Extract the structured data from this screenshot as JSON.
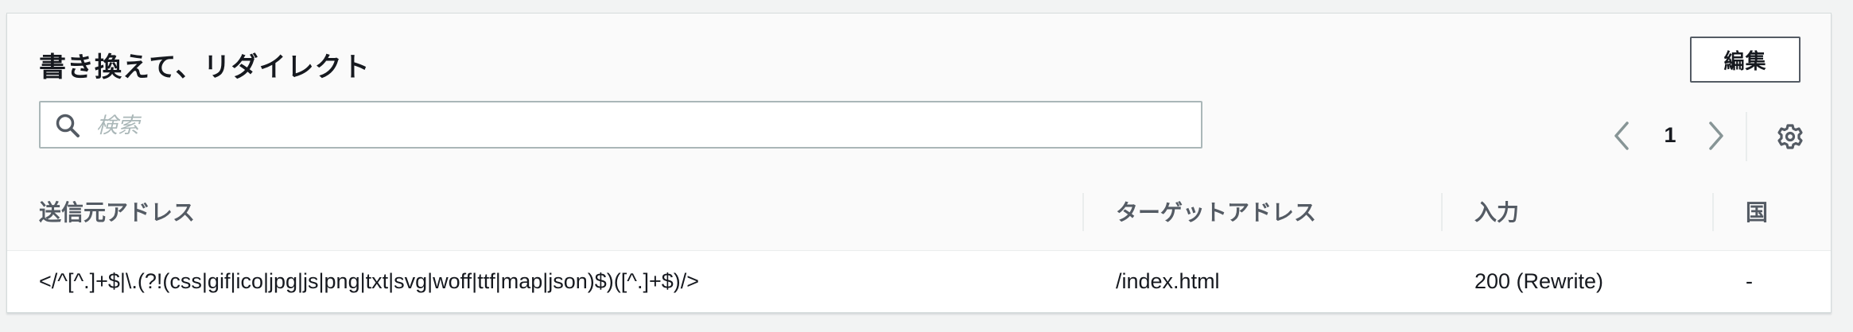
{
  "header": {
    "title": "書き換えて、リダイレクト",
    "edit_label": "編集"
  },
  "search": {
    "placeholder": "検索",
    "value": ""
  },
  "pagination": {
    "current_page": "1"
  },
  "table": {
    "columns": [
      "送信元アドレス",
      "ターゲットアドレス",
      "入力",
      "国"
    ],
    "rows": [
      [
        "</^[^.]+$|\\.(?!(css|gif|ico|jpg|js|png|txt|svg|woff|ttf|map|json)$)([^.]+$)/>",
        "/index.html",
        "200 (Rewrite)",
        "-"
      ]
    ]
  },
  "icons": {
    "search": "search-icon",
    "prev": "chevron-left-icon",
    "next": "chevron-right-icon",
    "settings": "gear-icon"
  },
  "colors": {
    "text": "#16191f",
    "muted": "#545b64",
    "placeholder": "#aab7b8",
    "border": "#aab7b8",
    "background": "#f2f3f3"
  }
}
